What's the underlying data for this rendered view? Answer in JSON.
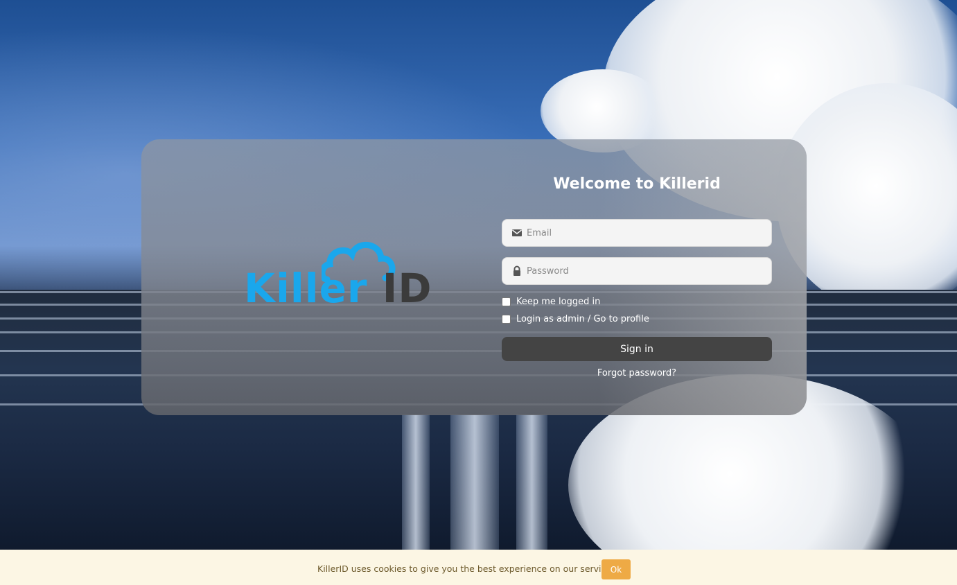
{
  "login": {
    "title": "Welcome to Killerid",
    "email_placeholder": "Email",
    "password_placeholder": "Password",
    "keep_logged_in_label": "Keep me logged in",
    "admin_login_label": "Login as admin / Go to profile",
    "sign_in_label": "Sign in",
    "forgot_password_label": "Forgot password?"
  },
  "logo": {
    "text_primary": "Killer",
    "text_secondary": "ID",
    "primary_color": "#1aa7ec",
    "secondary_color": "#3b3b3b",
    "icon": "cloud-icon"
  },
  "cookie_banner": {
    "text": "KillerID uses cookies to give you the best experience on our service.",
    "button_label": "Ok",
    "button_color": "#eeaa45"
  },
  "icons": {
    "email": "envelope-icon",
    "password": "lock-icon"
  }
}
